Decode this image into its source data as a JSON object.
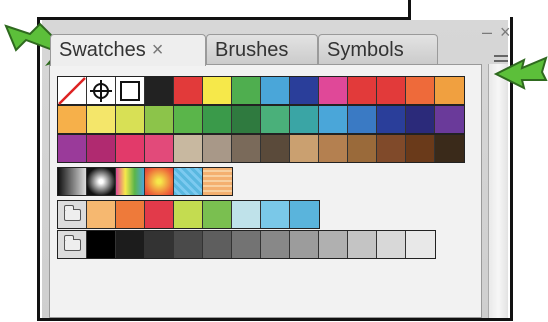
{
  "panel": {
    "tabs": [
      {
        "label": "Swatches",
        "close": "×",
        "active": true
      },
      {
        "label": "Brushes",
        "active": false
      },
      {
        "label": "Symbols",
        "active": false
      }
    ],
    "close_glyph": "×",
    "minimize_glyph": "–",
    "menu_icon": "panel-menu-icon"
  },
  "swatches": {
    "row1": [
      {
        "type": "none"
      },
      {
        "type": "registration"
      },
      {
        "type": "white"
      },
      {
        "color": "#222222"
      },
      {
        "color": "#e23a3a"
      },
      {
        "color": "#f6e84a"
      },
      {
        "color": "#4fae4f"
      },
      {
        "color": "#4aa6d9"
      },
      {
        "color": "#2a3e9a"
      },
      {
        "color": "#e04898"
      },
      {
        "color": "#e23a3a"
      },
      {
        "color": "#e23a3a"
      },
      {
        "color": "#ee6a3a"
      },
      {
        "color": "#f0a040"
      }
    ],
    "row2": [
      "#f6b04a",
      "#f4e66a",
      "#d8e055",
      "#8cc44a",
      "#5ab54a",
      "#3a9a4a",
      "#2f7a3f",
      "#4ab07a",
      "#3aa5a5",
      "#4aa6d9",
      "#3a7ac4",
      "#2a3e9a",
      "#2b2a7a",
      "#6a3a9a"
    ],
    "row3": [
      "#9a3a9a",
      "#b02a70",
      "#e23a6a",
      "#e24a7a",
      "#c8b8a0",
      "#a89888",
      "#7a6a5a",
      "#5a4a3a",
      "#caa070",
      "#b48050",
      "#9a6a3a",
      "#804a2a",
      "#6a3a1a",
      "#3a2a1a"
    ],
    "row4": [
      "gradient-black",
      "gradient-radial",
      "gradient-spectrum",
      "gradient-orange",
      "pattern-blue",
      "pattern-orange"
    ],
    "row5": [
      "#f6b870",
      "#ee7a3a",
      "#e23a4a",
      "#c4dc50",
      "#7abf50",
      "#bfe2ea",
      "#7ac8e8",
      "#5ab4dc"
    ],
    "row6": [
      "#000000",
      "#1c1c1c",
      "#333333",
      "#4a4a4a",
      "#5e5e5e",
      "#737373",
      "#888888",
      "#9c9c9c",
      "#b0b0b0",
      "#c4c4c4",
      "#d8d8d8",
      "#e8e8e8"
    ]
  },
  "accent": {
    "arrow": "#5cbf3a"
  }
}
